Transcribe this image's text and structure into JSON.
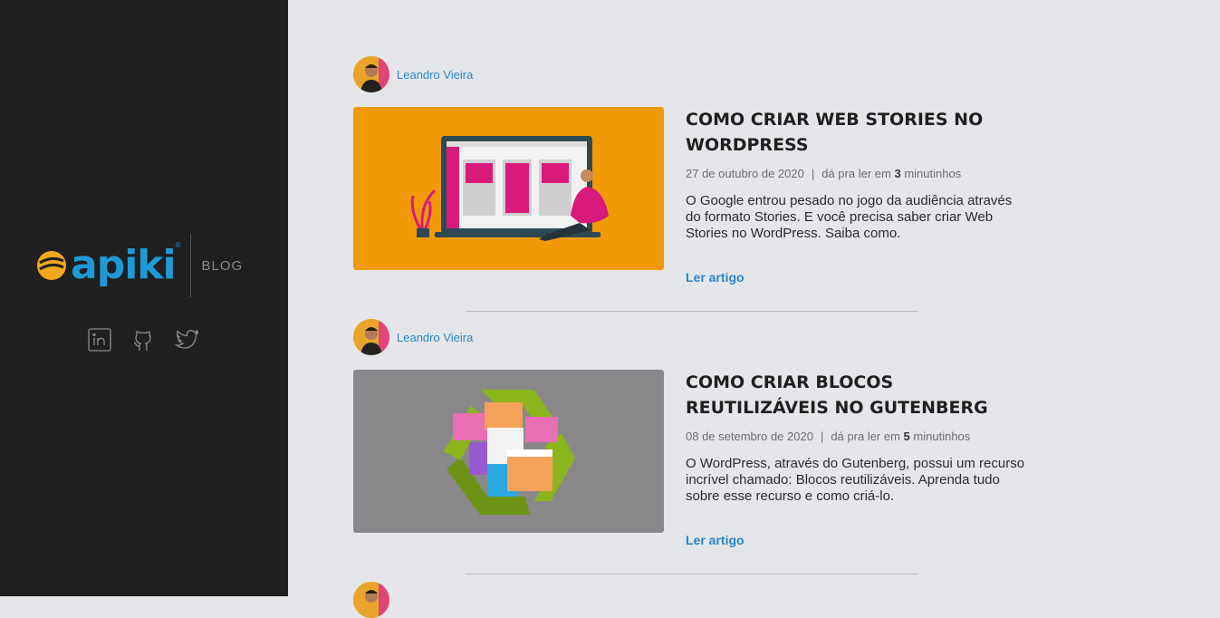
{
  "sidebar": {
    "logo_text": "apiki",
    "logo_reg": "®",
    "blog_label": "BLOG",
    "social": [
      "linkedin-icon",
      "github-icon",
      "twitter-icon"
    ]
  },
  "posts": [
    {
      "author": "Leandro Vieira",
      "title": "COMO CRIAR WEB STORIES NO WORDPRESS",
      "date": "27 de outubro de 2020",
      "read_prefix": "dá pra ler em",
      "read_minutes": "3",
      "read_suffix": "minutinhos",
      "excerpt": "O Google entrou pesado no jogo da audiência através do formato Stories. E você precisa saber criar Web Stories no WordPress. Saiba como.",
      "read_more": "Ler artigo",
      "thumb_color": "#f29a06"
    },
    {
      "author": "Leandro Vieira",
      "title": "COMO CRIAR BLOCOS REUTILIZÁVEIS NO GUTENBERG",
      "date": "08 de setembro de 2020",
      "read_prefix": "dá pra ler em",
      "read_minutes": "5",
      "read_suffix": "minutinhos",
      "excerpt": "O WordPress, através do Gutenberg, possui um recurso incrível chamado: Blocos reutilizáveis. Aprenda tudo sobre esse recurso e como criá-lo.",
      "read_more": "Ler artigo",
      "thumb_color": "#8a878a"
    }
  ],
  "colors": {
    "sidebar_bg": "#1f1f1f",
    "page_bg": "#e4e6e9",
    "accent": "#2b86c5"
  }
}
